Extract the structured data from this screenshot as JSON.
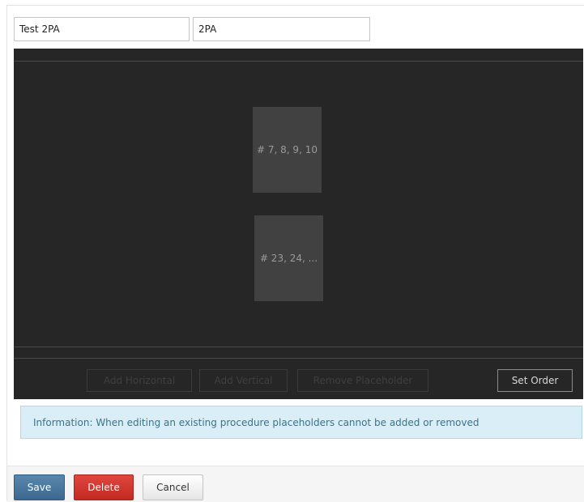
{
  "form": {
    "name_value": "Test 2PA",
    "abbreviation_value": "2PA"
  },
  "editor": {
    "placeholders": [
      {
        "label": "# 7, 8, 9, 10"
      },
      {
        "label": "# 23, 24, ..."
      }
    ],
    "toolbar": {
      "add_horizontal_label": "Add Horizontal",
      "add_vertical_label": "Add Vertical",
      "remove_placeholder_label": "Remove Placeholder",
      "set_order_label": "Set Order"
    }
  },
  "info": {
    "message": "Information: When editing an existing procedure placeholders cannot be added or removed"
  },
  "footer": {
    "save_label": "Save",
    "delete_label": "Delete",
    "cancel_label": "Cancel"
  },
  "colors": {
    "editor_background": "#262626",
    "placeholder_background": "#414141",
    "info_background": "#d9eef6",
    "save_button": "#4a77a0",
    "delete_button": "#d0362e"
  }
}
